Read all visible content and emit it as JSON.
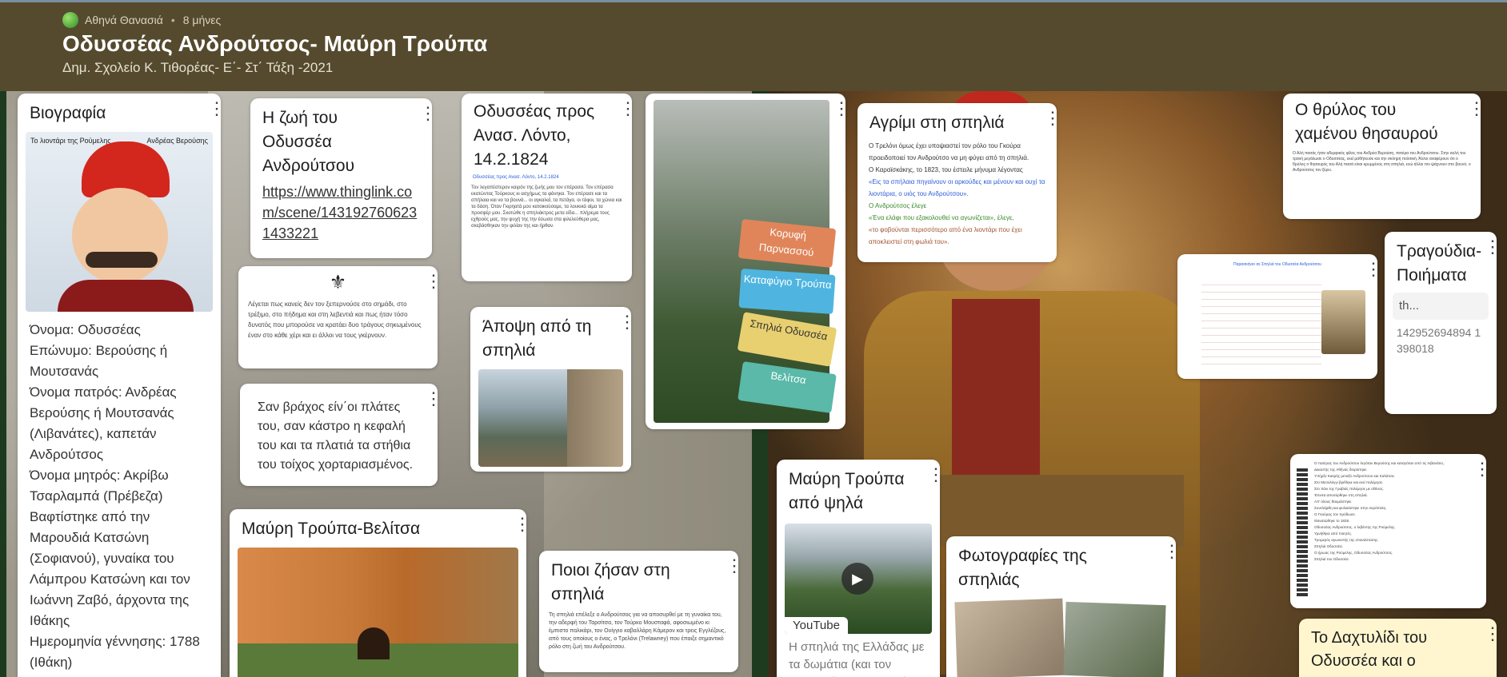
{
  "header": {
    "author": "Αθηνά Θανασιά",
    "age": "8 μήνες",
    "title": "Οδυσσέας Ανδρούτσος- Μαύρη Τρούπα",
    "subtitle": "Δημ. Σχολείο Κ. Τιθορέας- Ε΄- Στ΄ Τάξη -2021"
  },
  "cards": {
    "bio": {
      "title": "Βιογραφία",
      "img_caption_left": "Το λιοντάρι της Ρούμελης",
      "img_caption_right": "Ανδρέας Βερούσης",
      "text": "Όνομα: Οδυσσέας\nΕπώνυμο: Βερούσης ή Μουτσανάς\nΌνομα πατρός: Ανδρέας Βερούσης ή Μουτσανάς (Λιβανάτες), καπετάν Ανδρούτσος\nΌνομα μητρός: Ακρίβω Τσαρλαμπά (Πρέβεζα) Βαφτίστηκε από την Μαρουδιά Κατσώνη (Σοφιανού), γυναίκα του Λάμπρου Κατσώνη και τον  Ιωάννη Ζαβό, άρχοντα της Ιθάκης\nΗμερομηνία γέννησης: 1788 (Ιθάκη)"
    },
    "life": {
      "title": "Η ζωή του Οδυσσέα Ανδρούτσου",
      "link": "https://www.thinglink.com/scene/1431927606231433221"
    },
    "quote1": {
      "text": "Λέγεται πως κανείς δεν τον ξεπερνούσε στο σημάδι, στο τρέξιμο, στο πήδημα και στη λεβεντιά και πως ήταν τόσο δυνατός που μπορούσε να κρατάει δυο τράγους σηκωμένους έναν στο κάθε χέρι και  ει άλλοι να τους γκέρνουν."
    },
    "poem": {
      "text": "Σαν βράχος είν΄οι πλάτες του, σαν κάστρο η κεφαλή του και τα πλατιά τα στήθια του τοίχος χορταριασμένος."
    },
    "letter": {
      "title": "Οδυσσέας προς Ανασ. Λόντο, 14.2.1824",
      "doc_head": "Οδυσσέας προς Ανασ. Λόντο, 14.2.1824",
      "doc_body": "Τον λεγαπέστερον καιρόν της ζωής μου τον επέρασα. Τον επέρασα εκατώντας Τούρκους κι ασχήμως τα φάνηκα. Τον επέρασε και τα σπήλαια και να τα βουνά... οι αγκαλαί, τα πετάγα, οι τάφοι, τα χώνια και τα δάση. Όταν Γκιρηατά μου κατοικούσαμε, τα λουκικά αίμα τα προσφέρ μου. Σκοτώθε η σπηλιάκτρος μετα είδα... πλήρεμα τους εχθρούς μας, την ψυχή της την έσωσα στα φιλελεύθερα μας, σκεβάσθηκαν την φιλίαν της και ήρθαν."
    },
    "view": {
      "title": "Άποψη από τη σπηλιά"
    },
    "signs": {
      "sign1": "Κορυφή Παρνασσού",
      "sign2": "Καταφύγιο Τρούπα",
      "sign3": "Σπηλιά Οδυσσέα",
      "sign4": "Βελίτσα"
    },
    "wild": {
      "title": "Αγρίμι στη σπηλιά",
      "text1": "Ο Τρελόνι όμως έχει υποψιαστεί τον ρόλο του Γκούρα προειδοποιεί τον Ανδρούτσο να μη φύγει από τη σπηλιά.",
      "text2": "Ο Καραϊσκάκης, το 1823, του έστειλε μήνυμα λέγοντας",
      "text3": "«Εις τα σπήλαια πηγαίνουν οι αρκούδες και μένουν και ουχί τα λιοντάρια, ο υιός του Ανδρούτσου».",
      "text4": "Ο Ανδρούτσος έλεγε",
      "text5": "«Ένα ελάφι που εξακολουθεί να αγωνίζεται», έλεγε,",
      "text6": "«το φοβούνται περισσότερο από ένα λιοντάρι που έχει αποκλειστεί στη φωλιά του»."
    },
    "treasure": {
      "title": "Ο θρύλος του χαμένου θησαυρού",
      "text": "Ο Αλή πασάς ήταν αδερφικός φίλος του Ανδρέα Βερούση, πατέρα του Ανδρούτσου. Στην αυλή του τρανή μεγάλωσε ο Οδυσσέας, εκεί μαθήτευσε και την σκληρή πολιτική. Άλλοι αναφέρουν ότι ο θρύλος ο θησαυρός του Αλή πασά είναι κρυμμένος στη σπηλιά, ενώ άλλοι τον ψάχνουν στο βουνό, ο Ανδρούτσος τον ξέρει."
    },
    "notes": {
      "text": "Παρασκήνιο σε Σπηλιά του Οδυσσέα Ανδρούτσου"
    },
    "songs": {
      "title": "Τραγούδια-Ποιήματα",
      "preview": "th...",
      "number": "142952694894 1398018"
    },
    "belitsa": {
      "title": "Μαύρη Τρούπα-Βελίτσα"
    },
    "who": {
      "title": "Ποιοι ζήσαν στη σπηλιά",
      "text": "Τη σπηλιά επέλεξε ο Ανδρούτσος για να αποσυρθεί με τη γυναίκα του, την αδερφή του Ταρσίτσα, τον Τούρκο Μουσταφά, αφοσιωμένο κι έμπιστο παλικάρι, τον Ουίγγιο καβαλλάρη Κάμερον και τρεις Εγγλέζους, από τους οποίους ο ένας, ο Τρελόνι (Trelawney) που έπαιξε σημαντικό ρόλο στη ζωή του Ανδρούτσου."
    },
    "above": {
      "title": "Μαύρη Τρούπα από ψηλά",
      "badge": "YouTube",
      "text": "Η σπηλιά της Ελλάδας με τα δωμάτια (και τον θησαυρό) - Ο Οδυσσέας"
    },
    "photos": {
      "title": "Φωτογραφίες της σπηλιάς"
    },
    "acrostic": {
      "text": "Ο πατέρας του Ανδρούτσου λεγόταν Βερούσης και καταγόταν από τις Λιβανάτες.\nΔικαστής της Αθήνας διορίστηκε.\nΥπήρξε Κακρής μεταξύ Ανδρούτσου και Καλάτσα.\nΣτο Μεσολόγγι βρέθηκε και εκεί πολέμησε.\nΣτο Χάνι της Γραβιάς πολέμησε με σθένος.\nΈπειτα αποσύρθηκε στη σπηλιά.\nΑπ' όλους θαυμάστηκε.\nΣυνελήφθη και φυλακίστηκε στην Ακρόπολη.\nΟ Γκούρας τον πρόδωσε.\nΘανατώθηκε το 1825.\nΟδυσσέας Ανδρούτσος, ο λεβέντης της Ρούμελης.\nΥμνήθηκε από ποιητές.\nΤρομερός αγωνιστής της επανάστασης.\nΣπηλιά Οδυσσέα.\nΟ ήρωας της Ρούμελης, Οδυσσέας Ανδρούτσος.\nΣπηλιά του Οδυσσέα"
    },
    "ring": {
      "title": "Το Δαχτυλίδι του Οδυσσέα και ο"
    }
  }
}
